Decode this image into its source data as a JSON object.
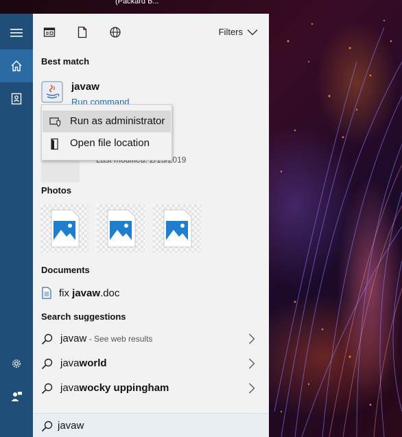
{
  "window": {
    "title": "(Packard B..."
  },
  "colors": {
    "accent": "#1f4e78",
    "accent_active": "#2a6ba3",
    "link": "#1a6fc0",
    "photo_blue": "#1e7fd0"
  },
  "rail": {
    "items": [
      {
        "icon": "hamburger-icon"
      },
      {
        "icon": "home-icon",
        "active": true
      },
      {
        "icon": "notebook-icon"
      },
      {
        "icon": "gear-icon"
      },
      {
        "icon": "user-feedback-icon"
      }
    ]
  },
  "topbar": {
    "icons": [
      "apps-icon",
      "documents-icon",
      "web-icon"
    ],
    "filters_label": "Filters"
  },
  "best_match": {
    "title": "Best match",
    "name": "javaw",
    "subtitle": "Run command",
    "ghost_meta": "Last modified: 2/15/2019"
  },
  "context_menu": {
    "items": [
      {
        "label": "Run as administrator",
        "icon": "shield-icon",
        "hover": true
      },
      {
        "label": "Open file location",
        "icon": "file-location-icon"
      }
    ]
  },
  "photos": {
    "title": "Photos",
    "count": 3
  },
  "documents": {
    "title": "Documents",
    "items": [
      {
        "prefix": "fix ",
        "bold": "javaw",
        "suffix": ".doc"
      }
    ]
  },
  "suggestions": {
    "title": "Search suggestions",
    "items": [
      {
        "normal": "javaw",
        "bold": "",
        "muted": " - See web results"
      },
      {
        "normal": "java",
        "bold": "world",
        "muted": ""
      },
      {
        "normal": "java",
        "bold": "wocky uppingham",
        "muted": ""
      }
    ]
  },
  "search": {
    "value": "javaw"
  }
}
